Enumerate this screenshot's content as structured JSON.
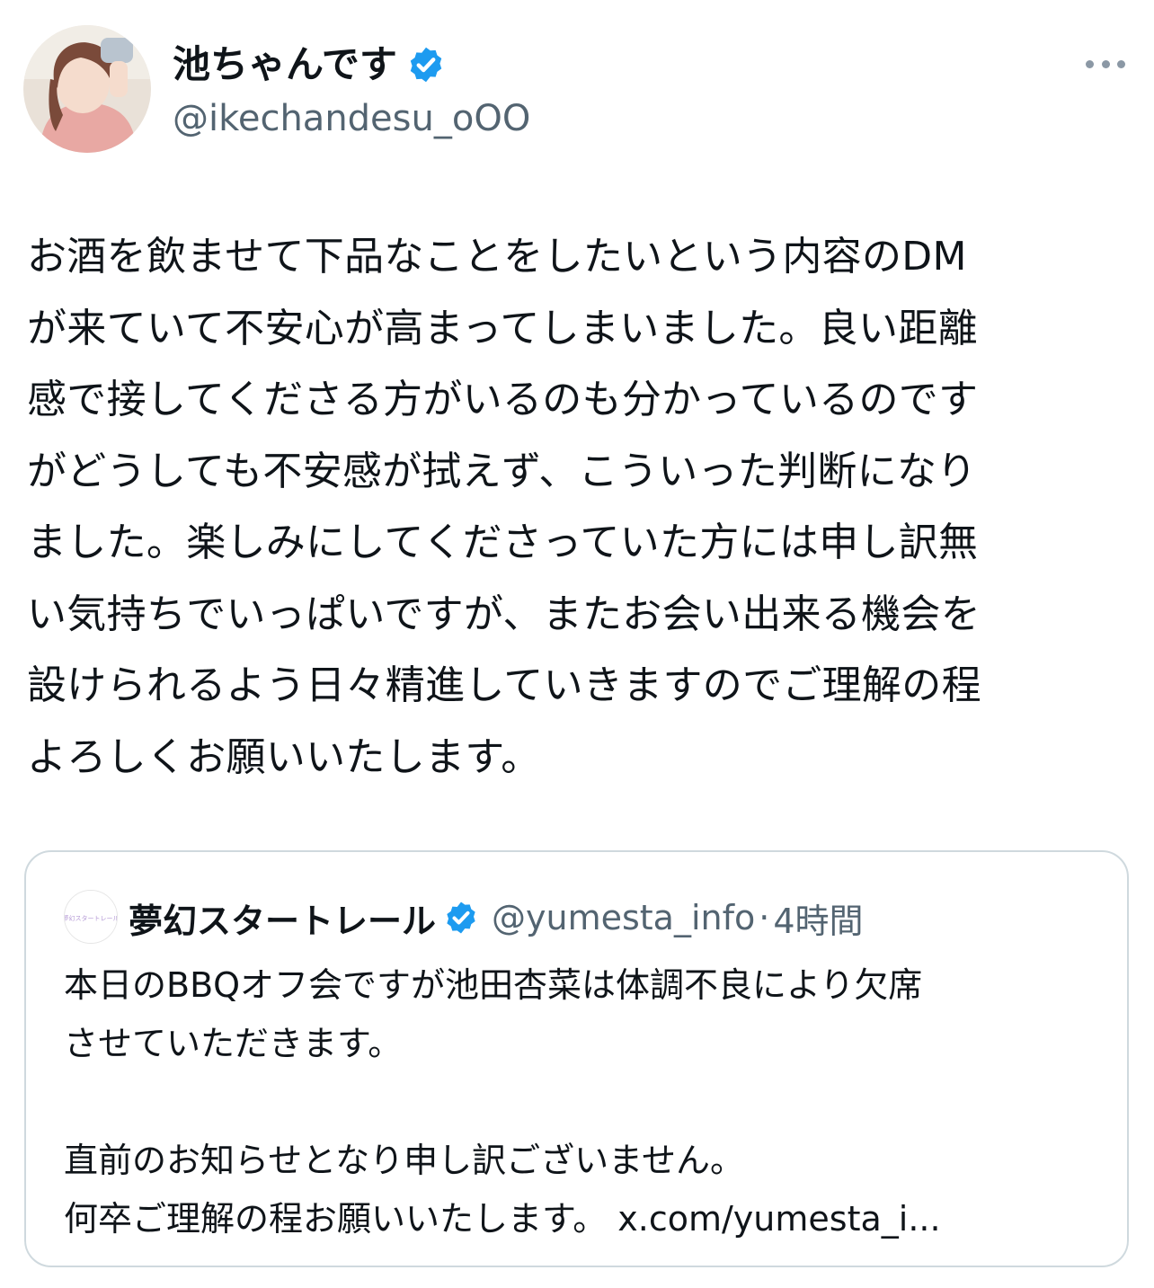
{
  "author": {
    "display_name": "池ちゃんです",
    "handle": "@ikechandesu_oOO",
    "verified": true,
    "avatar_icon": "profile-photo"
  },
  "menu_icon": "more-horizontal-icon",
  "tweet": {
    "text": "お酒を飲ませて下品なことをしたいという内容のDM\nが来ていて不安心が高まってしまいました。良い距離\n感で接してくださる方がいるのも分かっているのです\nがどうしても不安感が拭えず、こういった判断になり\nました。楽しみにしてくださっていた方には申し訳無\nい気持ちでいっぱいですが、またお会い出来る機会を\n設けられるよう日々精進していきますのでご理解の程\nよろしくお願いいたします。"
  },
  "quote": {
    "avatar_text": "夢幻スタートレール",
    "display_name": "夢幻スタートレール",
    "verified": true,
    "handle": "@yumesta_info",
    "separator": "·",
    "time": "4時間",
    "text": "本日のBBQオフ会ですが池田杏菜は体調不良により欠席\nさせていただきます。\n\n直前のお知らせとなり申し訳ございません。\n何卒ご理解の程お願いいたします。 x.com/yumesta_i..."
  },
  "colors": {
    "text": "#0f1419",
    "secondary": "#536471",
    "verified": "#1d9bf0",
    "border": "#cfd9de"
  }
}
